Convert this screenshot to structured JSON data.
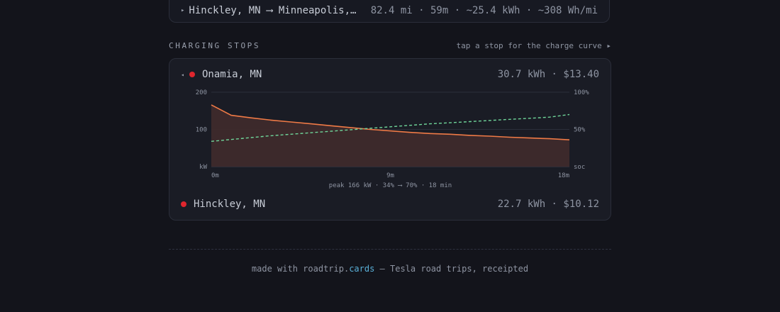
{
  "leg": {
    "arrow": "▸",
    "route": "Hinckley, MN ⟶ Minneapolis,…",
    "stats": "82.4 mi · 59m · ~25.4 kWh · ~308 Wh/mi"
  },
  "section": {
    "title": "CHARGING STOPS",
    "hint": "tap a stop for the charge curve ▸"
  },
  "stops": [
    {
      "caret": "◂",
      "name": "Onamia, MN",
      "meta": "30.7 kWh · $13.40",
      "expanded": true
    },
    {
      "caret": "",
      "name": "Hinckley, MN",
      "meta": "22.7 kWh · $10.12",
      "expanded": false
    }
  ],
  "colors": {
    "stop_dot": "#e0262e",
    "power_line": "#ef7a46",
    "power_fill": "#3e2a2b",
    "soc_line": "#6fd69a",
    "accent_link": "#5ab0d8"
  },
  "chart_data": {
    "type": "line",
    "title": "",
    "x": [
      0,
      1,
      2,
      3,
      4,
      5,
      6,
      7,
      8,
      9,
      10,
      11,
      12,
      13,
      14,
      15,
      16,
      17,
      18
    ],
    "xticks": [
      "0m",
      "9m",
      "18m"
    ],
    "xlim": [
      0,
      18
    ],
    "y_left": {
      "unit_label": "kW",
      "ticks": [
        "200",
        "100"
      ],
      "ylim": [
        0,
        200
      ]
    },
    "y_right": {
      "unit_label": "soc",
      "ticks": [
        "100%",
        "50%"
      ],
      "ylim": [
        0,
        100
      ]
    },
    "series": [
      {
        "key": "power_kw",
        "axis": "left",
        "style": "area",
        "values": [
          166,
          138,
          131,
          125,
          120,
          115,
          110,
          105,
          100,
          96,
          92,
          89,
          87,
          84,
          82,
          79,
          77,
          75,
          72
        ]
      },
      {
        "key": "soc_pct",
        "axis": "right",
        "style": "dashed",
        "values": [
          34,
          36.5,
          39,
          41.5,
          43.5,
          45.5,
          47.5,
          49.5,
          51.5,
          53.5,
          55.5,
          57.5,
          59,
          60.5,
          62,
          63.5,
          65,
          66.5,
          70
        ]
      }
    ],
    "summary": "peak 166 kW · 34% ⟶ 70% · 18 min"
  },
  "footer": {
    "prefix": "made with roadtrip.",
    "brand": "cards",
    "suffix": " — Tesla road trips, receipted"
  }
}
